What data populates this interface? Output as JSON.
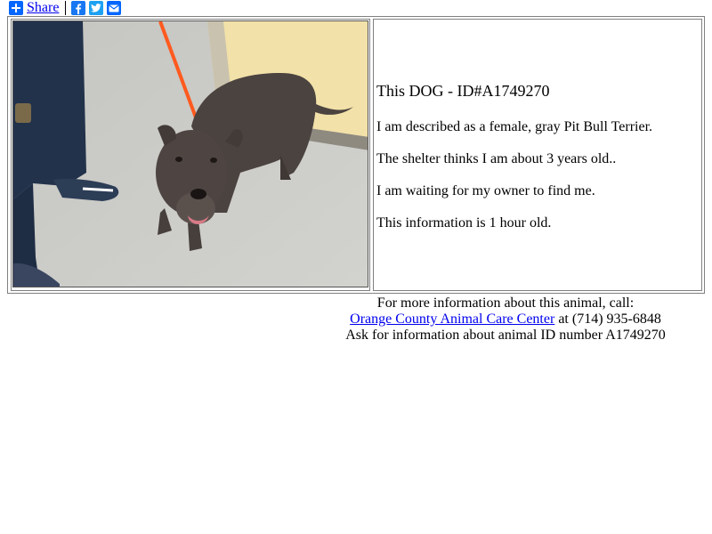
{
  "share": {
    "label": "Share",
    "services": [
      "facebook-icon",
      "twitter-icon",
      "email-icon"
    ],
    "colors": {
      "share": "#0166ff",
      "facebook": "#1877f2",
      "twitter": "#1da1f2",
      "email": "#0166ff"
    }
  },
  "animal": {
    "title": "This DOG - ID#A1749270",
    "lines": [
      "I am described as a female, gray Pit Bull Terrier.",
      "The shelter thinks I am about 3 years old..",
      "I am waiting for my owner to find me.",
      "This information is 1 hour old."
    ]
  },
  "footer": {
    "line1": "For more information about this animal, call:",
    "shelter_link": "Orange County Animal Care Center",
    "phone_text": " at (714) 935-6848",
    "line3": "Ask for information about animal ID number A1749270"
  }
}
